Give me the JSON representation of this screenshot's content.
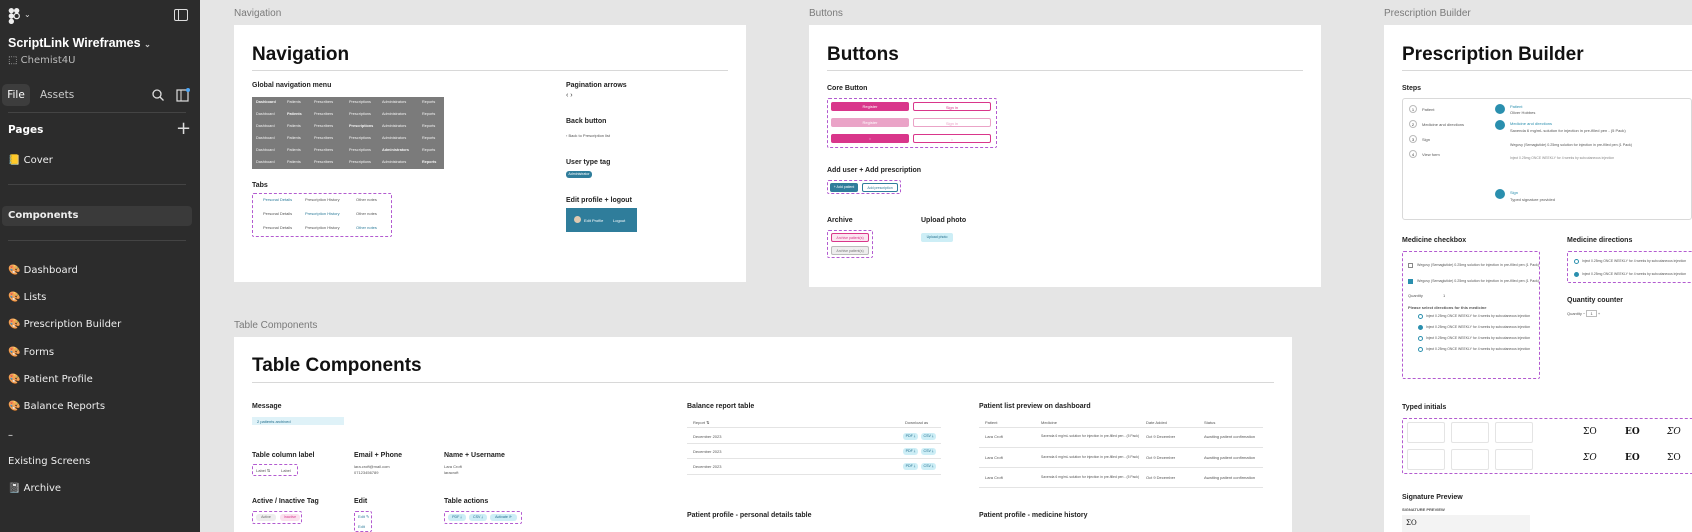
{
  "sidebar": {
    "project_title": "ScriptLink Wireframes",
    "project_sub": "Chemist4U",
    "tabs": {
      "file": "File",
      "assets": "Assets"
    },
    "pages_heading": "Pages",
    "pages": [
      {
        "label": "📒 Cover"
      },
      {
        "label": "Components"
      },
      {
        "label": "🎨 Dashboard"
      },
      {
        "label": "🎨 Lists"
      },
      {
        "label": "🎨 Prescription Builder"
      },
      {
        "label": "🎨 Forms"
      },
      {
        "label": "🎨 Patient Profile"
      },
      {
        "label": "🎨 Balance Reports"
      },
      {
        "label": "–"
      },
      {
        "label": "Existing Screens"
      },
      {
        "label": "📓 Archive"
      }
    ]
  },
  "frames": {
    "navigation": {
      "label": "Navigation",
      "title": "Navigation",
      "global_nav": "Global navigation menu",
      "nav_items": [
        "Dashboard",
        "Patients",
        "Prescribers",
        "Prescriptions",
        "Administrators",
        "Reports"
      ],
      "tabs_label": "Tabs",
      "tab_items": [
        "Personal Details",
        "Prescription History",
        "Other notes"
      ],
      "pagination": "Pagination arrows",
      "pagination_glyph": "‹ ›",
      "back_button": "Back button",
      "back_text": "Back to Prescription list",
      "user_tag": "User type tag",
      "user_tag_text": "Administrator",
      "edit_profile": "Edit profile + logout",
      "edit_text": "Edit Profile",
      "logout_text": "Logout"
    },
    "buttons": {
      "label": "Buttons",
      "title": "Buttons",
      "core": "Core Button",
      "btn_primary": "Register",
      "btn_secondary": "Sign in",
      "add_user": "Add user + Add prescription",
      "add_patient": "+ Add patient",
      "add_prescription": "Add prescription",
      "archive": "Archive",
      "archive_btn1": "Archive patient(s)",
      "archive_btn2": "Archive patient(s)",
      "upload": "Upload photo",
      "upload_btn": "Upload photo"
    },
    "prescription": {
      "label": "Prescription Builder",
      "title": "Prescription Builder",
      "steps": "Steps",
      "step_items": [
        "Patient",
        "Medicine and directions",
        "Sign",
        "View form"
      ],
      "step_details": [
        {
          "title": "Patient",
          "sub": "Oliver Hobbes"
        },
        {
          "title": "Medicine and directions",
          "sub": "Saxenda 6 mg/mL solution for injection in pre-filled pen - (5 Pack)"
        },
        {
          "title": "Sign",
          "sub": "Typed signature provided"
        }
      ],
      "med_line2": "Wegovy (Semaglutide) 0.25mg solution for injection in pre-filled pen (1 Pack)",
      "checkbox": "Medicine checkbox",
      "checkbox_items": [
        "Wegovy (Semaglutide) 0.25mg solution for injection in pre-filled pen (1 Pack)",
        "Wegovy (Semaglutide) 0.25mg solution for injection in pre-filled pen (1 Pack)"
      ],
      "quantity_lbl": "Quantity",
      "qty_val": "1",
      "select_dir": "Please select directions for this medicine",
      "direction_opt": "Inject 0.25mg ONCE WEEKLY for 4 weeks by subcutaneous injection",
      "directions": "Medicine directions",
      "qty_counter": "Quantity counter",
      "typed_initials": "Typed initials",
      "initials": [
        "ΣO",
        "EO",
        "ΣO",
        "ΣO",
        "EO",
        "ΣO"
      ],
      "sig_preview": "Signature Preview",
      "sig_preview_small": "SIGNATURE PREVIEW",
      "sig_val": "ΣO"
    },
    "table": {
      "label": "Table Components",
      "title": "Table Components",
      "message": "Message",
      "message_text": "2 patients archived",
      "col_label": "Table column label",
      "col_a": "Label ⇅",
      "col_b": "Label",
      "email_phone": "Email + Phone",
      "email": "lara.croft@mail.com",
      "phone": "07123456789",
      "name_user": "Name + Username",
      "name": "Lara Croft",
      "username": "laracroft",
      "active_tag": "Active / Inactive Tag",
      "active": "Active",
      "inactive": "Inactive",
      "edit": "Edit",
      "edit_a": "Edit ✎",
      "edit_b": "Edit",
      "table_actions": "Table actions",
      "act_pdf": "PDF ⤓",
      "act_csv": "CSV ⤓",
      "act_activate": "Activate ⟳",
      "balance": "Balance report table",
      "bal_head": [
        "Report ⇅",
        "Download as"
      ],
      "bal_rows": [
        "December 2023",
        "December 2023",
        "December 2023"
      ],
      "pdf": "PDF ⤓",
      "csv": "CSV ⤓",
      "patient_list": "Patient list preview on dashboard",
      "pl_head": [
        "Patient",
        "Medicine",
        "Date Added",
        "Status"
      ],
      "pl_rows": [
        {
          "p": "Lara Croft",
          "m": "Saxenda 6 mg/mL solution for injection in pre-filled pen - (5 Pack)",
          "d": "Oct 9 December",
          "s": "Awaiting patient confirmation"
        },
        {
          "p": "Lara Croft",
          "m": "Saxenda 6 mg/mL solution for injection in pre-filled pen - (5 Pack)",
          "d": "Oct 9 December",
          "s": "Awaiting patient confirmation"
        },
        {
          "p": "Lara Croft",
          "m": "Saxenda 6 mg/mL solution for injection in pre-filled pen - (5 Pack)",
          "d": "Oct 9 December",
          "s": "Awaiting patient confirmation"
        }
      ],
      "personal": "Patient profile - personal details table",
      "med_history": "Patient profile - medicine history"
    }
  },
  "colors": {
    "pink": "#d9368b",
    "navy": "#2f7d9b",
    "teal": "#2a8fae",
    "purple_dash": "#b35bd0"
  }
}
